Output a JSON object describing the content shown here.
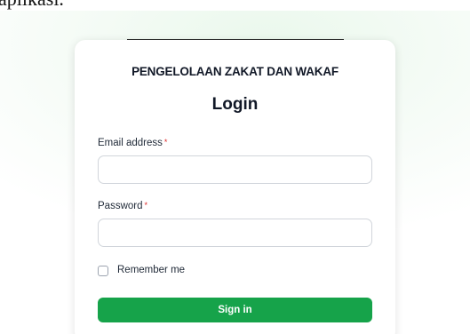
{
  "document": {
    "caption_fragment": "aplikasi."
  },
  "login_card": {
    "app_title": "PENGELOLAAN ZAKAT DAN WAKAF",
    "heading": "Login",
    "email": {
      "label": "Email address",
      "required_mark": "*",
      "value": ""
    },
    "password": {
      "label": "Password",
      "required_mark": "*",
      "value": ""
    },
    "remember": {
      "label": "Remember me",
      "checked": false
    },
    "sign_in_label": "Sign in"
  },
  "colors": {
    "primary": "#16a34a",
    "required": "#dc2626",
    "text": "#111827"
  }
}
